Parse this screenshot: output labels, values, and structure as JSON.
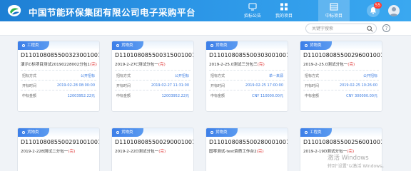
{
  "header": {
    "site_title": "中国节能环保集团有限公司电子采购平台",
    "nav": [
      {
        "label": "招标公告",
        "icon": "monitor-icon",
        "active": false
      },
      {
        "label": "我的项目",
        "icon": "grid-icon",
        "active": false
      },
      {
        "label": "中标项目",
        "icon": "table-icon",
        "active": true
      }
    ],
    "notification_count": "55"
  },
  "search": {
    "placeholder": "关键字搜索"
  },
  "cards": [
    {
      "category": "工程类",
      "number": "D110108085500323001001",
      "title": "演示C标项目测试20190228002分包1",
      "status": "(完)",
      "rows": [
        {
          "k": "招标方式",
          "v": "公开招标"
        },
        {
          "k": "开标时间",
          "v": "2019-02-28 08:00:00"
        },
        {
          "k": "中标金额",
          "v": "12003952.22元"
        }
      ]
    },
    {
      "category": "货物类",
      "number": "D110108085500315001001",
      "title": "2019-2-27C测试分包一",
      "status": "(完)",
      "rows": [
        {
          "k": "招标方式",
          "v": "公开招标"
        },
        {
          "k": "开标时间",
          "v": "2019-02-27 11:31:00"
        },
        {
          "k": "中标金额",
          "v": "12003952.22元"
        }
      ]
    },
    {
      "category": "货物类",
      "number": "D110108085500303001001",
      "title": "2019-2-25.0测试三分包三",
      "status": "(完)",
      "rows": [
        {
          "k": "招标方式",
          "v": "单一来源"
        },
        {
          "k": "开标时间",
          "v": "2019-02-25 17:00:00"
        },
        {
          "k": "中标金额",
          "v": "CNY 110000.00元"
        }
      ]
    },
    {
      "category": "货物类",
      "number": "D110108085500296001001",
      "title": "2019-2-25.0测试分包一",
      "status": "(完)",
      "rows": [
        {
          "k": "招标方式",
          "v": "公开招标"
        },
        {
          "k": "开标时间",
          "v": "2019-02-25 10:26:00"
        },
        {
          "k": "中标金额",
          "v": "CNY 300000.00元"
        }
      ]
    },
    {
      "category": "货物类",
      "number": "D110108085500291001001",
      "title": "2019-2-22B测试二分包一",
      "status": "(完)",
      "rows": []
    },
    {
      "category": "货物类",
      "number": "D110108085500290001001",
      "title": "2019-2-22D测试分包一",
      "status": "(完)",
      "rows": []
    },
    {
      "category": "货物类",
      "number": "D110108085500280001001",
      "title": "国零测试-test资质工作台2",
      "status": "(完)",
      "rows": []
    },
    {
      "category": "工程类",
      "number": "D110108085500256001001",
      "title": "2019-2-19D测试分包一",
      "status": "(完)",
      "rows": []
    }
  ],
  "watermark": {
    "line1": "激活 Windows",
    "line2": "转到\"设置\"以激活 Windows。"
  },
  "colors": {
    "header_blue": "#2b8fe2",
    "tag_blue": "#3d7fe8",
    "value_blue": "#3a7be0",
    "status_red": "#e03b3b",
    "badge_red": "#ff3b30"
  }
}
